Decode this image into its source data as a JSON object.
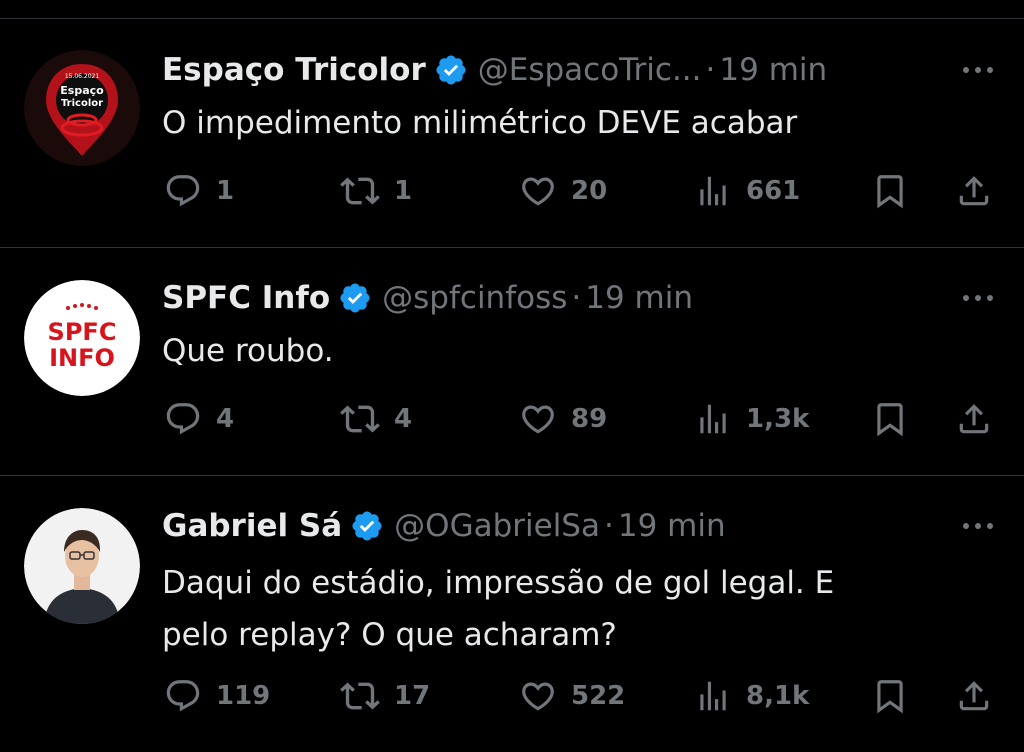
{
  "tweets": [
    {
      "display_name": "Espaço Tricolor",
      "handle": "@EspacoTric...",
      "separator": "·",
      "time": "19 min",
      "text_lines": [
        "O impedimento milimétrico DEVE acabar"
      ],
      "avatar": {
        "type": "logo",
        "date": "15.06.2021",
        "line1": "Espaço",
        "line2": "Tricolor"
      },
      "replies": "1",
      "reposts": "1",
      "likes": "20",
      "views": "661"
    },
    {
      "display_name": "SPFC Info",
      "handle": "@spfcinfoss",
      "separator": "·",
      "time": "19 min",
      "text_lines": [
        "Que roubo."
      ],
      "avatar": {
        "type": "logo",
        "line1": "SPFC",
        "line2": "INFO"
      },
      "replies": "4",
      "reposts": "4",
      "likes": "89",
      "views": "1,3k"
    },
    {
      "display_name": "Gabriel Sá",
      "handle": "@OGabrielSa",
      "separator": "·",
      "time": "19 min",
      "text_lines": [
        "Daqui do estádio, impressão de gol legal. E",
        "pelo replay? O que acharam?"
      ],
      "avatar": {
        "type": "photo"
      },
      "replies": "119",
      "reposts": "17",
      "likes": "522",
      "views": "8,1k"
    }
  ],
  "colors": {
    "background": "#000000",
    "text": "#e7e9ea",
    "secondary": "#71767b",
    "verified": "#1d9bf0",
    "divider": "#2f3336"
  },
  "icons": [
    "verified-badge-icon",
    "more-icon",
    "reply-icon",
    "repost-icon",
    "like-icon",
    "views-icon",
    "bookmark-icon",
    "share-icon"
  ]
}
